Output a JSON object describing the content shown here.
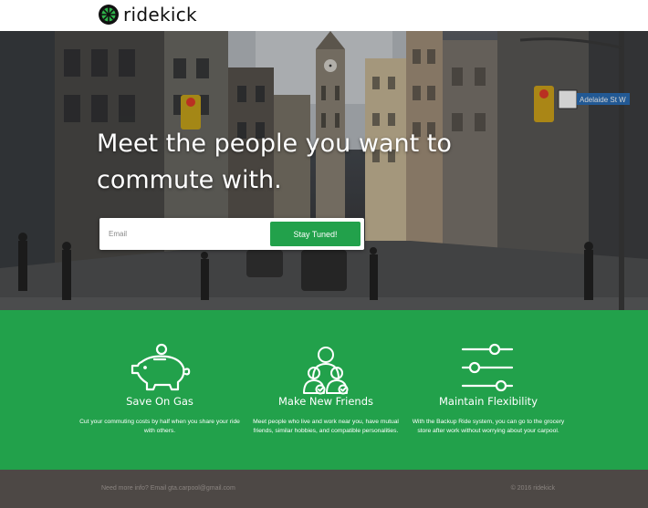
{
  "brand": {
    "name": "ridekick"
  },
  "hero": {
    "headline": "Meet the people you want to commute with.",
    "email_placeholder": "Email",
    "cta_label": "Stay Tuned!",
    "street_sign": "Adelaide St W"
  },
  "features": [
    {
      "icon": "piggy-bank-icon",
      "title": "Save On Gas",
      "text": "Cut your commuting costs by half when you share your ride with others."
    },
    {
      "icon": "friends-icon",
      "title": "Make New Friends",
      "text": "Meet people who live and work near you, have mutual friends, similar hobbies, and compatible personalities."
    },
    {
      "icon": "sliders-icon",
      "title": "Maintain Flexibility",
      "text": "With the Backup Ride system, you can go to the grocery store after work without worrying about your carpool."
    }
  ],
  "footer": {
    "contact": "Need more info? Email gta.carpool@gmail.com",
    "copyright": "© 2016 ridekick"
  },
  "colors": {
    "accent": "#22a14b",
    "footer_bg": "#4d4845",
    "footer_text": "#8a8480"
  }
}
